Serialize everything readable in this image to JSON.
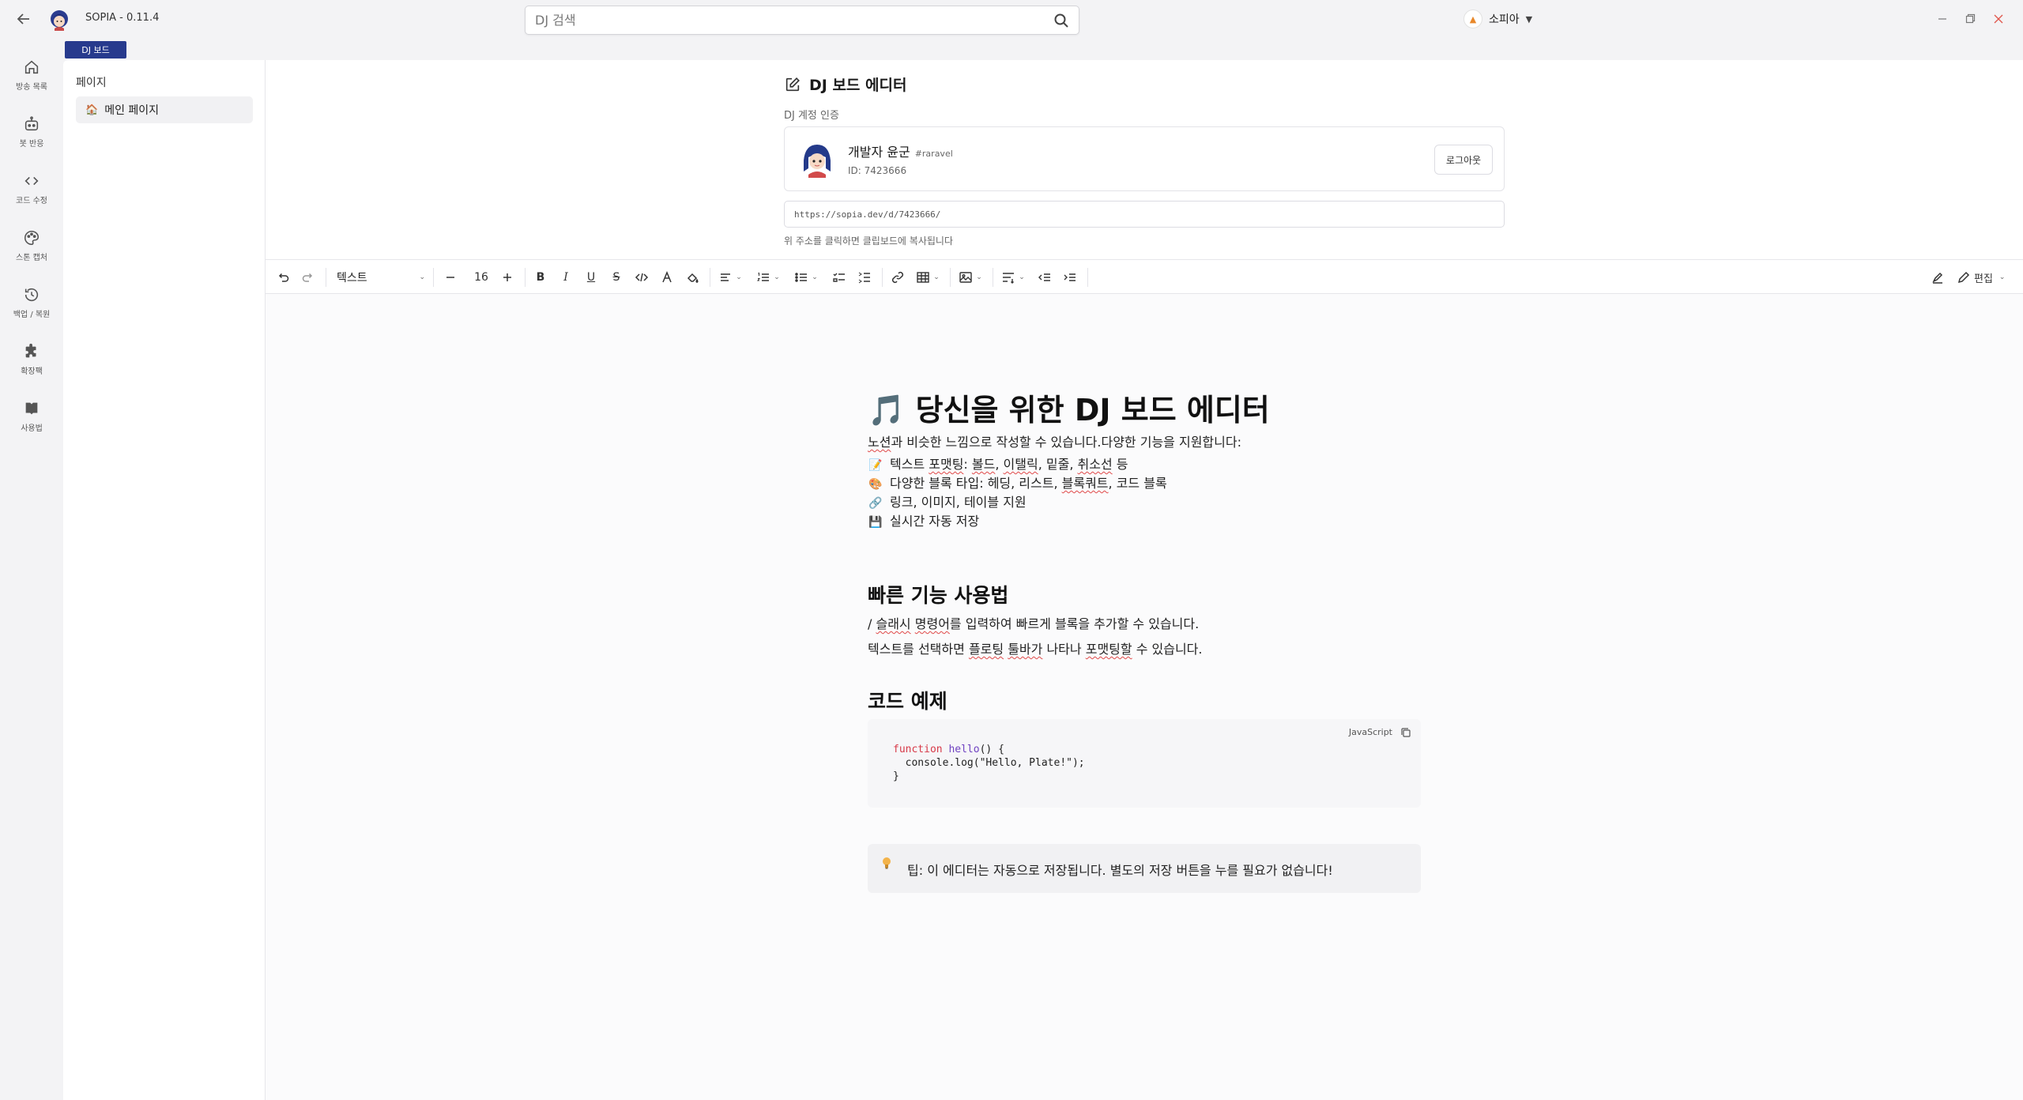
{
  "window": {
    "title": "SOPIA - 0.11.4",
    "search_placeholder": "DJ 검색",
    "user_name": "소피아"
  },
  "rail": [
    {
      "label": "방송 목록",
      "icon": "home-icon"
    },
    {
      "label": "봇 반응",
      "icon": "bot-icon"
    },
    {
      "label": "코드 수정",
      "icon": "code-icon"
    },
    {
      "label": "스톤 캡처",
      "icon": "palette-icon"
    },
    {
      "label": "백업 / 복원",
      "icon": "history-icon"
    },
    {
      "label": "확장팩",
      "icon": "puzzle-icon"
    },
    {
      "label": "사용법",
      "icon": "book-icon"
    }
  ],
  "tab": {
    "label": "DJ 보드"
  },
  "pages": {
    "title": "페이지",
    "items": [
      {
        "label": "메인 페이지",
        "icon": "house-emoji-icon"
      }
    ]
  },
  "editor_header": {
    "title": "DJ 보드 에디터",
    "section_label": "DJ 계정 인증"
  },
  "account": {
    "name": "개발자 윤군",
    "tag": "#raravel",
    "id_text": "ID: 7423666",
    "logout_label": "로그아웃",
    "url": "https://sopia.dev/d/7423666/",
    "url_hint": "위 주소를 클릭하면 클립보드에 복사됩니다"
  },
  "toolbar": {
    "block_type": "텍스트",
    "font_size": "16",
    "edit_label": "편집"
  },
  "doc": {
    "h1": "당신을 위한 DJ 보드 에디터",
    "intro_a": "노션",
    "intro_b": "과 비슷한 느낌으로 작성할 수 있습니다.다양한 기능을 지원합니다:",
    "features": [
      {
        "emoji": "📝",
        "parts": [
          "텍스트 ",
          "포맷팅",
          ": ",
          "볼드",
          ", ",
          "이탤릭",
          ", 밑줄, ",
          "취소선",
          " 등"
        ]
      },
      {
        "emoji": "🎨",
        "parts": [
          "다양한 블록 타입: 헤딩, 리스트, ",
          "블록쿼트",
          ", 코드 블록"
        ]
      },
      {
        "emoji": "🔗",
        "parts": [
          "링크, 이미지, 테이블 지원"
        ]
      },
      {
        "emoji": "💾",
        "parts": [
          "실시간 자동 저장"
        ]
      }
    ],
    "h2_quick": "빠른 기능 사용법",
    "quick_1_a": "/ ",
    "quick_1_b": "슬래시",
    "quick_1_c": " ",
    "quick_1_d": "명령어",
    "quick_1_e": "를 입력하여 빠르게 블록을 추가할 수 있습니다.",
    "quick_2_a": "텍스트를 선택하면 ",
    "quick_2_b": "플로팅",
    "quick_2_c": " ",
    "quick_2_d": "툴바가",
    "quick_2_e": " 나타나 ",
    "quick_2_f": "포맷팅할",
    "quick_2_g": " 수 있습니다.",
    "h2_code": "코드 예제",
    "code_lang": "JavaScript",
    "code_line1_kw": "function",
    "code_line1_fn": "hello",
    "code_line1_rest": "() {",
    "code_line2": "  console.log(\"Hello, Plate!\");",
    "code_line3": "}",
    "callout": "팁: 이 에디터는 자동으로 저장됩니다. 별도의 저장 버튼을 누를 필요가 없습니다!"
  },
  "colors": {
    "accent": "#273a8d",
    "background": "#f3f3f5",
    "panel": "#ffffff"
  }
}
